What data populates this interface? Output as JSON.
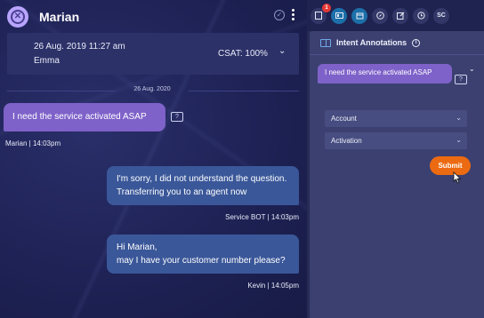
{
  "header": {
    "contact_name": "Marian",
    "verified_icon": "check-circle-icon",
    "menu_icon": "kebab-menu-icon"
  },
  "conversation_info": {
    "datetime": "26 Aug. 2019 11:27 am",
    "agent": "Emma",
    "csat": "CSAT: 100%",
    "expand_icon": "chevron-down-icon"
  },
  "chat": {
    "date_divider": "26 Aug. 2020",
    "messages": [
      {
        "direction": "incoming",
        "lines": [
          "I need the service activated ASAP"
        ],
        "meta": "Marian | 14:03pm"
      },
      {
        "direction": "outgoing",
        "lines": [
          "I'm sorry, I did not understand the question.",
          "Transferring you to an agent now"
        ],
        "meta": "Service BOT | 14:03pm"
      },
      {
        "direction": "outgoing",
        "lines": [
          "Hi Marian,",
          "may I have your customer number please?"
        ],
        "meta": "Kevin | 14:05pm"
      }
    ]
  },
  "toolbar": {
    "items": [
      {
        "icon": "document-icon",
        "badge": "1",
        "active": false
      },
      {
        "icon": "intent-annotations-icon",
        "active": true
      },
      {
        "icon": "book-icon",
        "active": true
      },
      {
        "icon": "compass-icon",
        "active": false
      },
      {
        "icon": "edit-icon",
        "active": false
      },
      {
        "icon": "history-icon",
        "active": false
      },
      {
        "label": "SC",
        "active": false
      }
    ]
  },
  "annotations": {
    "title": "Intent Annotations",
    "message": "I need the service activated ASAP",
    "category_select": "Account",
    "intent_select": "Activation",
    "submit_label": "Submit"
  },
  "colors": {
    "incoming_bubble": "#7e62c9",
    "outgoing_bubble": "#3a5799",
    "submit": "#ec6a12",
    "active_tool": "#1c6fa8"
  }
}
